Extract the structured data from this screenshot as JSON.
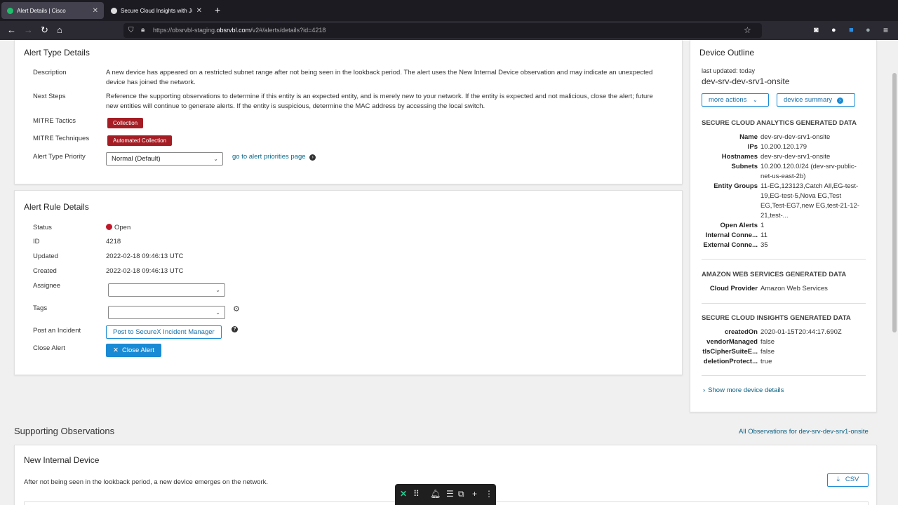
{
  "browser": {
    "tabs": [
      {
        "title": "Alert Details | Cisco",
        "active": true
      },
      {
        "title": "Secure Cloud Insights with Jupi",
        "active": false
      }
    ],
    "url_prefix": "https://obsrvbl-staging.",
    "url_domain": "obsrvbl.com",
    "url_path": "/v2#/alerts/details?id=4218"
  },
  "alert_type": {
    "title": "Alert Type Details",
    "description_label": "Description",
    "description": "A new device has appeared on a restricted subnet range after not being seen in the lookback period. The alert uses the New Internal Device observation and may indicate an unexpected device has joined the network.",
    "next_steps_label": "Next Steps",
    "next_steps": "Reference the supporting observations to determine if this entity is an expected entity, and is merely new to your network. If the entity is expected and not malicious, close the alert; future new entities will continue to generate alerts. If the entity is suspicious, determine the MAC address by accessing the local switch.",
    "tactics_label": "MITRE Tactics",
    "tactics": "Collection",
    "techniques_label": "MITRE Techniques",
    "techniques": "Automated Collection",
    "priority_label": "Alert Type Priority",
    "priority_value": "Normal (Default)",
    "priority_link": "go to alert priorities page"
  },
  "alert_rule": {
    "title": "Alert Rule Details",
    "status_label": "Status",
    "status_value": "Open",
    "id_label": "ID",
    "id_value": "4218",
    "updated_label": "Updated",
    "updated_value": "2022-02-18 09:46:13 UTC",
    "created_label": "Created",
    "created_value": "2022-02-18 09:46:13 UTC",
    "assignee_label": "Assignee",
    "tags_label": "Tags",
    "incident_label": "Post an Incident",
    "incident_button": "Post to SecureX Incident Manager",
    "close_label": "Close Alert",
    "close_button": "Close Alert"
  },
  "device_outline": {
    "title": "Device Outline",
    "last_updated": "last updated: today",
    "device_name": "dev-srv-dev-srv1-onsite",
    "more_actions": "more actions",
    "device_summary": "device summary",
    "sca_header": "SECURE CLOUD ANALYTICS GENERATED DATA",
    "sca_rows": [
      {
        "k": "Name",
        "v": "dev-srv-dev-srv1-onsite"
      },
      {
        "k": "IPs",
        "v": "10.200.120.179"
      },
      {
        "k": "Hostnames",
        "v": "dev-srv-dev-srv1-onsite"
      },
      {
        "k": "Subnets",
        "v": "10.200.120.0/24 (dev-srv-public-net-us-east-2b)"
      },
      {
        "k": "Entity Groups",
        "v": "11-EG,123123,Catch All,EG-test-19,EG-test-5,Nova EG,Test EG,Test-EG7,new EG,test-21-12-21,test-..."
      },
      {
        "k": "Open Alerts",
        "v": "1"
      },
      {
        "k": "Internal Conne...",
        "v": "11"
      },
      {
        "k": "External Conne...",
        "v": "35"
      }
    ],
    "aws_header": "AMAZON WEB SERVICES GENERATED DATA",
    "aws_rows": [
      {
        "k": "Cloud Provider",
        "v": "Amazon Web Services"
      }
    ],
    "sci_header": "SECURE CLOUD INSIGHTS GENERATED DATA",
    "sci_rows": [
      {
        "k": "createdOn",
        "v": "2020-01-15T20:44:17.690Z"
      },
      {
        "k": "vendorManaged",
        "v": "false"
      },
      {
        "k": "tlsCipherSuiteE...",
        "v": "false"
      },
      {
        "k": "deletionProtect...",
        "v": "true"
      }
    ],
    "show_more": "Show more device details"
  },
  "supporting": {
    "title": "Supporting Observations",
    "all_link": "All Observations for dev-srv-dev-srv1-onsite",
    "obs_title": "New Internal Device",
    "obs_desc": "After not being seen in the lookback period, a new device emerges on the network.",
    "csv": "CSV"
  },
  "colors": {
    "accent": "#1a8ad4",
    "badge": "#a51d24",
    "status_open": "#c0182a"
  }
}
